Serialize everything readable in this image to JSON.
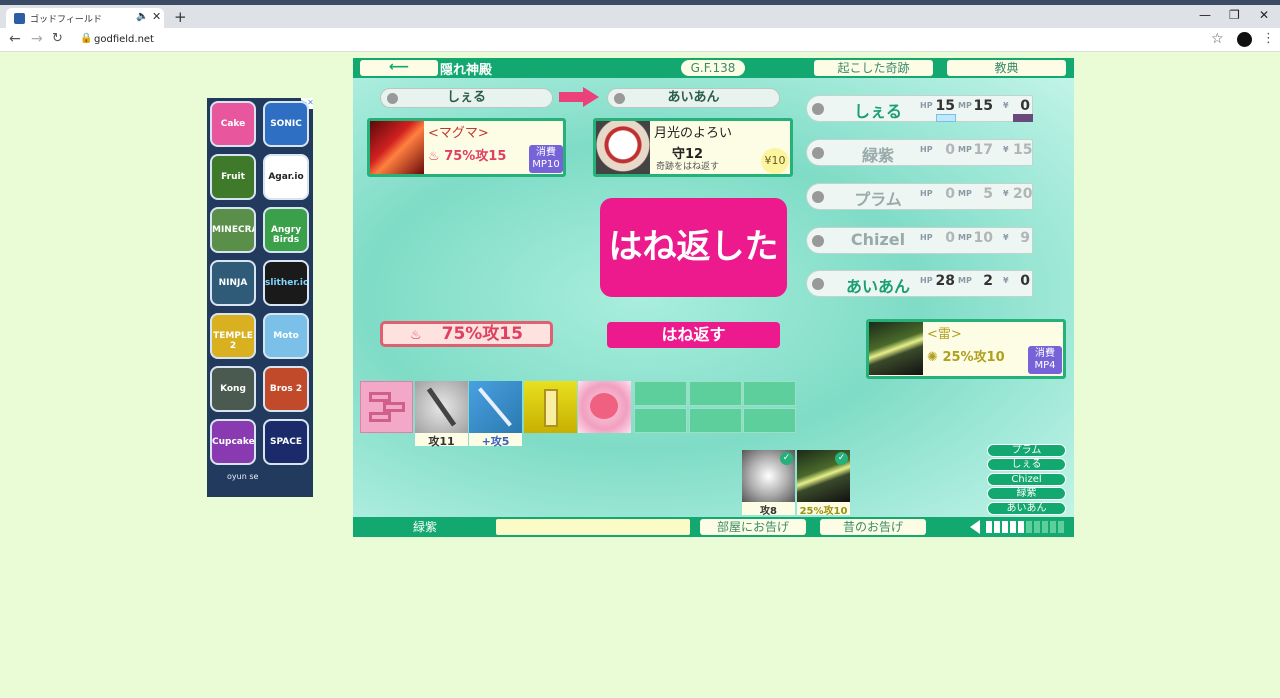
{
  "browser": {
    "tab_title": "ゴッドフィールド",
    "url": "godfield.net"
  },
  "game": {
    "room_name": "隠れ神殿",
    "gf_label": "G.F.138",
    "miracles_button": "起こした奇跡",
    "scripture_button": "教典",
    "attacker": "しぇる",
    "defender": "あいあん",
    "attack_card": {
      "name": "<マグマ>",
      "effect": "75%攻15",
      "cost_label": "消費",
      "cost": "MP10"
    },
    "defense_card": {
      "name": "月光のよろい",
      "effect": "守12",
      "desc": "奇跡をはね返す",
      "price": "¥10"
    },
    "banner": "はね返した",
    "action_button": "はね返す",
    "attack_pill": "75%攻15",
    "side_card": {
      "name": "<雷>",
      "effect": "25%攻10",
      "cost_label": "消費",
      "cost": "MP4"
    },
    "players": [
      {
        "name": "しぇる",
        "hp_label": "HP",
        "hp": "15",
        "mp_label": "MP",
        "mp": "15",
        "money_label": "¥",
        "money": "0",
        "alive": true
      },
      {
        "name": "緑紫",
        "hp_label": "HP",
        "hp": "0",
        "mp_label": "MP",
        "mp": "17",
        "money_label": "¥",
        "money": "15",
        "alive": false
      },
      {
        "name": "プラム",
        "hp_label": "HP",
        "hp": "0",
        "mp_label": "MP",
        "mp": "5",
        "money_label": "¥",
        "money": "20",
        "alive": false
      },
      {
        "name": "Chizel",
        "hp_label": "HP",
        "hp": "0",
        "mp_label": "MP",
        "mp": "10",
        "money_label": "¥",
        "money": "9",
        "alive": false
      },
      {
        "name": "あいあん",
        "hp_label": "HP",
        "hp": "28",
        "mp_label": "MP",
        "mp": "2",
        "money_label": "¥",
        "money": "0",
        "alive": true
      }
    ],
    "hand_captions": [
      "攻11",
      "+攻5"
    ],
    "played_captions": [
      "攻8",
      "25%攻10"
    ],
    "turn_order": [
      "プラム",
      "しぇる",
      "Chizel",
      "緑紫",
      "あいあん"
    ],
    "current_player": "緑紫",
    "room_notice_button": "部屋にお告げ",
    "past_notice_button": "昔のお告げ",
    "volume_level": 0.5
  },
  "ad": {
    "icons": [
      "Cake",
      "SONIC",
      "Fruit",
      "Agar.io",
      "MINECRAFT",
      "Angry Birds",
      "NINJA",
      "slither.io",
      "TEMPLE 2",
      "Moto",
      "Kong",
      "Bros 2",
      "Cupcake",
      "SPACE"
    ],
    "logo": "oyun    se",
    "colors": {
      "frame": "#223a5e"
    }
  },
  "colors": {
    "accent_green": "#13a86f",
    "magenta": "#ec1a8c",
    "pink": "#ec407a",
    "cost_purple": "#7763d8"
  }
}
